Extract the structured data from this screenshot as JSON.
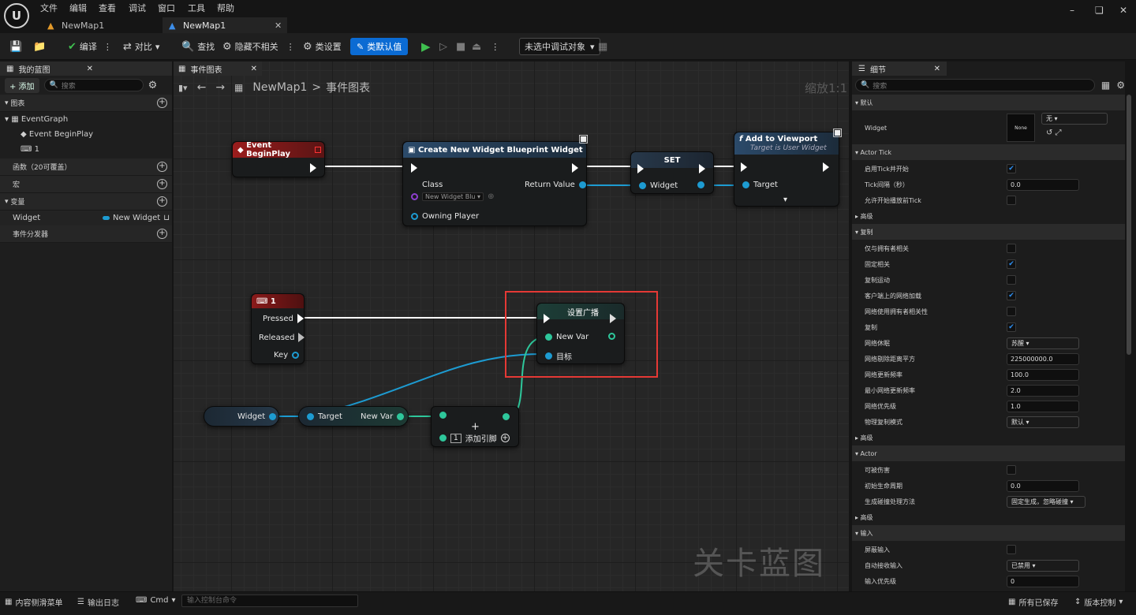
{
  "menu": {
    "items": [
      "文件",
      "编辑",
      "查看",
      "调试",
      "窗口",
      "工具",
      "帮助"
    ]
  },
  "tabs": [
    {
      "label": "NewMap1"
    },
    {
      "label": "NewMap1"
    }
  ],
  "toolbar": {
    "compile": "编译",
    "diff": "对比",
    "find": "查找",
    "hide_unrelated": "隐藏不相关",
    "class_settings": "类设置",
    "class_defaults": "类默认值",
    "debug_target": "未选中调试对象"
  },
  "left_panel": {
    "tab": "我的蓝图",
    "add": "+ 添加",
    "search_placeholder": "搜索",
    "sections": {
      "graphs": "图表",
      "functions": "函数（20可覆盖）",
      "macros": "宏",
      "variables": "变量",
      "dispatchers": "事件分发器"
    },
    "graph_items": {
      "event_graph": "EventGraph",
      "begin_play": "Event BeginPlay",
      "key_one": "1"
    },
    "variable": {
      "name": "Widget",
      "type": "New Widget"
    }
  },
  "graph": {
    "tab": "事件图表",
    "breadcrumb_root": "NewMap1",
    "breadcrumb_leaf": "事件图表",
    "zoom": "缩放1:1",
    "watermark": "关卡蓝图",
    "nodes": {
      "begin_play": "Event BeginPlay",
      "create_widget": {
        "title": "Create New Widget Blueprint Widget",
        "class_label": "Class",
        "class_value": "New Widget Blu",
        "return_value": "Return Value",
        "owning_player": "Owning Player"
      },
      "set": {
        "title": "SET",
        "pin": "Widget"
      },
      "add_viewport": {
        "title": "Add to Viewport",
        "subtitle": "Target is User Widget",
        "target": "Target"
      },
      "key_one": {
        "title": "1",
        "pressed": "Pressed",
        "released": "Released",
        "key": "Key"
      },
      "set_broadcast": {
        "title": "设置广播",
        "new_var": "New Var",
        "target": "目标"
      },
      "widget_get": "Widget",
      "get_var": {
        "target": "Target",
        "new_var": "New Var"
      },
      "array": {
        "add_pin": "添加引脚",
        "index": "1"
      }
    }
  },
  "details": {
    "tab": "细节",
    "search_placeholder": "搜索",
    "rows": [
      {
        "type": "cat",
        "label": "默认"
      },
      {
        "type": "widget",
        "label": "Widget",
        "thumb": "None",
        "value": "无"
      },
      {
        "type": "cat",
        "label": "Actor Tick"
      },
      {
        "type": "check",
        "label": "启用Tick并开始",
        "checked": true
      },
      {
        "type": "field",
        "label": "Tick间隔（秒）",
        "value": "0.0"
      },
      {
        "type": "check",
        "label": "允许开始播放前Tick",
        "checked": false
      },
      {
        "type": "sub",
        "label": "高级"
      },
      {
        "type": "cat",
        "label": "复制"
      },
      {
        "type": "check",
        "label": "仅与拥有者相关",
        "checked": false
      },
      {
        "type": "check",
        "label": "固定相关",
        "checked": true
      },
      {
        "type": "check",
        "label": "复制运动",
        "checked": false
      },
      {
        "type": "check",
        "label": "客户端上的网络加载",
        "checked": true
      },
      {
        "type": "check",
        "label": "网络使用拥有者相关性",
        "checked": false
      },
      {
        "type": "check",
        "label": "复制",
        "checked": true
      },
      {
        "type": "select",
        "label": "网络休眠",
        "value": "苏醒"
      },
      {
        "type": "field",
        "label": "网络剔除距离平方",
        "value": "225000000.0"
      },
      {
        "type": "field",
        "label": "网络更新频率",
        "value": "100.0"
      },
      {
        "type": "field",
        "label": "最小网络更新频率",
        "value": "2.0"
      },
      {
        "type": "field",
        "label": "网络优先级",
        "value": "1.0"
      },
      {
        "type": "select",
        "label": "物理复制模式",
        "value": "默认"
      },
      {
        "type": "sub",
        "label": "高级"
      },
      {
        "type": "cat",
        "label": "Actor"
      },
      {
        "type": "check",
        "label": "可被伤害",
        "checked": false
      },
      {
        "type": "field",
        "label": "初始生命周期",
        "value": "0.0"
      },
      {
        "type": "select",
        "label": "生成碰撞处理方法",
        "value": "固定生成，忽略碰撞"
      },
      {
        "type": "sub",
        "label": "高级"
      },
      {
        "type": "cat",
        "label": "输入"
      },
      {
        "type": "check",
        "label": "屏蔽输入",
        "checked": false
      },
      {
        "type": "select",
        "label": "自动接收输入",
        "value": "已禁用"
      },
      {
        "type": "field",
        "label": "输入优先级",
        "value": "0"
      }
    ]
  },
  "status": {
    "content_drawer": "内容侧滑菜单",
    "output_log": "输出日志",
    "cmd": "Cmd",
    "console_placeholder": "输入控制台命令",
    "all_saved": "所有已保存",
    "source_control": "版本控制"
  }
}
